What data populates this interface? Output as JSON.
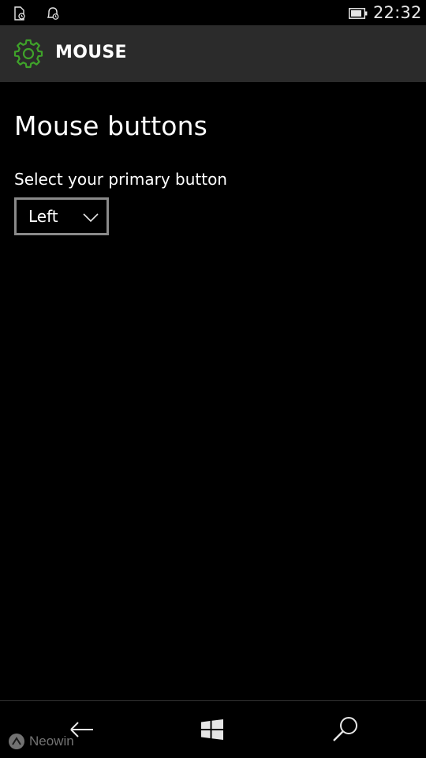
{
  "status_bar": {
    "time": "22:32",
    "icons": [
      "notification-doc-icon",
      "alarm-icon",
      "battery-icon"
    ]
  },
  "header": {
    "icon": "gear-icon",
    "title": "MOUSE",
    "accent_color": "#3fa22a"
  },
  "main": {
    "section_title": "Mouse buttons",
    "primary_button": {
      "label": "Select your primary button",
      "selected_value": "Left"
    }
  },
  "nav_bar": {
    "buttons": [
      "back-arrow-icon",
      "windows-logo-icon",
      "search-icon"
    ]
  },
  "watermark": {
    "text": "Neowin"
  }
}
